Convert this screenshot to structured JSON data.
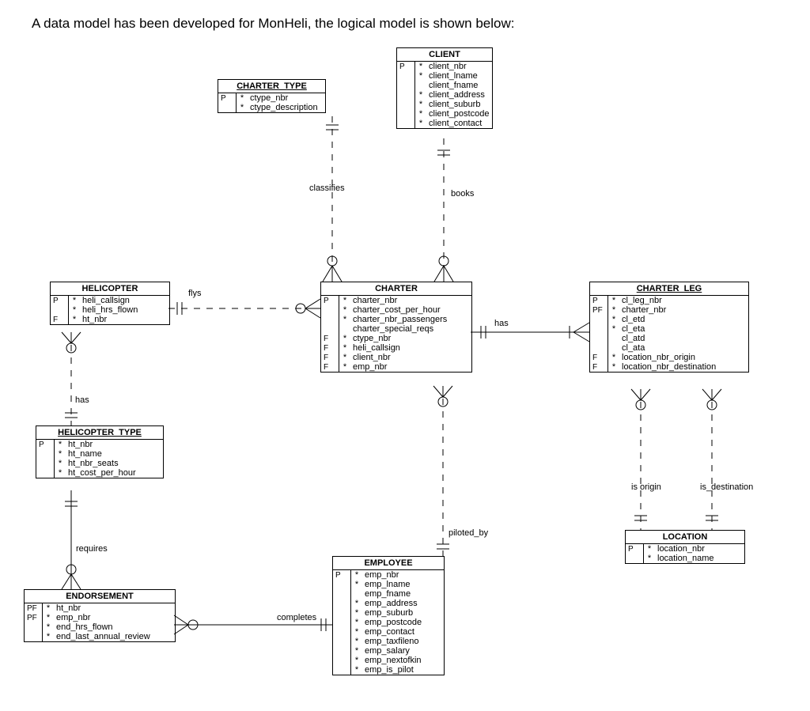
{
  "intro": "A data model has been developed for MonHeli, the logical model is shown below:",
  "entities": {
    "CLIENT": {
      "title": "CLIENT",
      "attrs": [
        {
          "k": "P",
          "b": "*",
          "n": "client_nbr"
        },
        {
          "k": "",
          "b": "*",
          "n": "client_lname"
        },
        {
          "k": "",
          "b": "",
          "n": "client_fname"
        },
        {
          "k": "",
          "b": "*",
          "n": "client_address"
        },
        {
          "k": "",
          "b": "*",
          "n": "client_suburb"
        },
        {
          "k": "",
          "b": "*",
          "n": "client_postcode"
        },
        {
          "k": "",
          "b": "*",
          "n": "client_contact"
        }
      ]
    },
    "CHARTER_TYPE": {
      "title": "CHARTER_TYPE",
      "attrs": [
        {
          "k": "P",
          "b": "*",
          "n": "ctype_nbr"
        },
        {
          "k": "",
          "b": "*",
          "n": "ctype_description"
        }
      ]
    },
    "HELICOPTER": {
      "title": "HELICOPTER",
      "attrs": [
        {
          "k": "P",
          "b": "*",
          "n": "heli_callsign"
        },
        {
          "k": "",
          "b": "*",
          "n": "heli_hrs_flown"
        },
        {
          "k": "F",
          "b": "*",
          "n": "ht_nbr"
        }
      ]
    },
    "CHARTER": {
      "title": "CHARTER",
      "attrs": [
        {
          "k": "P",
          "b": "*",
          "n": "charter_nbr"
        },
        {
          "k": "",
          "b": "*",
          "n": "charter_cost_per_hour"
        },
        {
          "k": "",
          "b": "*",
          "n": "charter_nbr_passengers"
        },
        {
          "k": "",
          "b": "",
          "n": "charter_special_reqs"
        },
        {
          "k": "F",
          "b": "*",
          "n": "ctype_nbr"
        },
        {
          "k": "F",
          "b": "*",
          "n": "heli_callsign"
        },
        {
          "k": "F",
          "b": "*",
          "n": "client_nbr"
        },
        {
          "k": "F",
          "b": "*",
          "n": "emp_nbr"
        }
      ]
    },
    "CHARTER_LEG": {
      "title": "CHARTER_LEG",
      "attrs": [
        {
          "k": "P",
          "b": "*",
          "n": "cl_leg_nbr"
        },
        {
          "k": "PF",
          "b": "*",
          "n": "charter_nbr"
        },
        {
          "k": "",
          "b": "*",
          "n": "cl_etd"
        },
        {
          "k": "",
          "b": "*",
          "n": "cl_eta"
        },
        {
          "k": "",
          "b": "",
          "n": "cl_atd"
        },
        {
          "k": "",
          "b": "",
          "n": "cl_ata"
        },
        {
          "k": "F",
          "b": "*",
          "n": "location_nbr_origin"
        },
        {
          "k": "F",
          "b": "*",
          "n": "location_nbr_destination"
        }
      ]
    },
    "HELICOPTER_TYPE": {
      "title": "HELICOPTER_TYPE",
      "attrs": [
        {
          "k": "P",
          "b": "*",
          "n": "ht_nbr"
        },
        {
          "k": "",
          "b": "*",
          "n": "ht_name"
        },
        {
          "k": "",
          "b": "*",
          "n": "ht_nbr_seats"
        },
        {
          "k": "",
          "b": "*",
          "n": "ht_cost_per_hour"
        }
      ]
    },
    "ENDORSEMENT": {
      "title": "ENDORSEMENT",
      "attrs": [
        {
          "k": "PF",
          "b": "*",
          "n": "ht_nbr"
        },
        {
          "k": "PF",
          "b": "*",
          "n": "emp_nbr"
        },
        {
          "k": "",
          "b": "*",
          "n": "end_hrs_flown"
        },
        {
          "k": "",
          "b": "*",
          "n": "end_last_annual_review"
        }
      ]
    },
    "LOCATION": {
      "title": "LOCATION",
      "attrs": [
        {
          "k": "P",
          "b": "*",
          "n": "location_nbr"
        },
        {
          "k": "",
          "b": "*",
          "n": "location_name"
        }
      ]
    },
    "EMPLOYEE": {
      "title": "EMPLOYEE",
      "attrs": [
        {
          "k": "P",
          "b": "*",
          "n": "emp_nbr"
        },
        {
          "k": "",
          "b": "*",
          "n": "emp_lname"
        },
        {
          "k": "",
          "b": "",
          "n": "emp_fname"
        },
        {
          "k": "",
          "b": "*",
          "n": "emp_address"
        },
        {
          "k": "",
          "b": "*",
          "n": "emp_suburb"
        },
        {
          "k": "",
          "b": "*",
          "n": "emp_postcode"
        },
        {
          "k": "",
          "b": "*",
          "n": "emp_contact"
        },
        {
          "k": "",
          "b": "*",
          "n": "emp_taxfileno"
        },
        {
          "k": "",
          "b": "*",
          "n": "emp_salary"
        },
        {
          "k": "",
          "b": "*",
          "n": "emp_nextofkin"
        },
        {
          "k": "",
          "b": "*",
          "n": "emp_is_pilot"
        }
      ]
    }
  },
  "relationships": {
    "flys": "flys",
    "classifies": "classifies",
    "books": "books",
    "has_charterleg": "has",
    "has_helitype": "has",
    "piloted_by": "piloted_by",
    "requires": "requires",
    "completes": "completes",
    "is_origin": "is origin",
    "is_destination": "is_destination"
  }
}
